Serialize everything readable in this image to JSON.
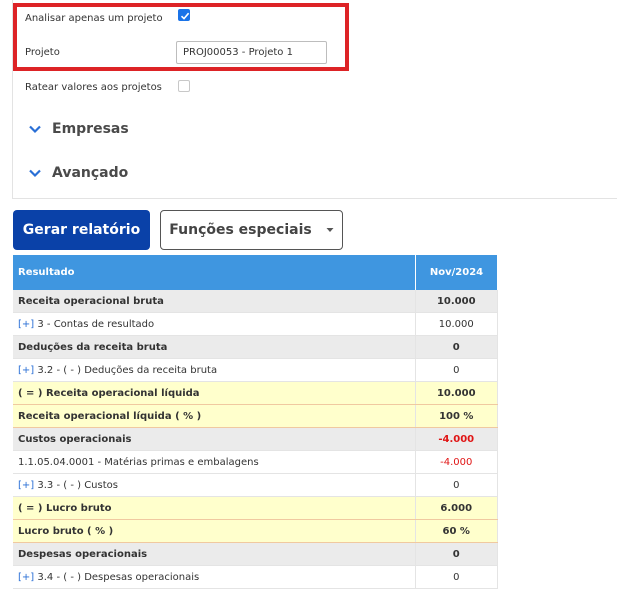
{
  "form": {
    "single_project_label": "Analisar apenas um projeto",
    "single_project_checked": true,
    "project_label": "Projeto",
    "project_value": "PROJ00053 - Projeto 1",
    "prorate_label": "Ratear valores aos projetos",
    "prorate_checked": false
  },
  "sections": {
    "empresas": "Empresas",
    "avancado": "Avançado"
  },
  "actions": {
    "generate_label": "Gerar relatório",
    "special_label": "Funções especiais"
  },
  "table": {
    "headers": [
      "Resultado",
      "Nov/2024"
    ],
    "expander": "[+]",
    "rows": [
      {
        "type": "group",
        "label": "Receita operacional bruta",
        "value": "10.000"
      },
      {
        "type": "detail",
        "expandable": true,
        "label": "3 - Contas de resultado",
        "value": "10.000"
      },
      {
        "type": "group",
        "label": "Deduções da receita bruta",
        "value": "0"
      },
      {
        "type": "detail",
        "expandable": true,
        "label": "3.2 - ( - ) Deduções da receita bruta",
        "value": "0"
      },
      {
        "type": "total",
        "label": "( = ) Receita operacional líquida",
        "value": "10.000"
      },
      {
        "type": "total",
        "label": "Receita operacional líquida ( % )",
        "value": "100 %"
      },
      {
        "type": "group",
        "label": "Custos operacionais",
        "value": "-4.000",
        "negative": true
      },
      {
        "type": "detail",
        "expandable": false,
        "label": "1.1.05.04.0001 - Matérias primas e embalagens",
        "value": "-4.000",
        "negative": true
      },
      {
        "type": "detail",
        "expandable": true,
        "label": "3.3 - ( - ) Custos",
        "value": "0"
      },
      {
        "type": "total",
        "label": "( = ) Lucro bruto",
        "value": "6.000"
      },
      {
        "type": "total",
        "label": "Lucro bruto ( % )",
        "value": "60 %"
      },
      {
        "type": "group",
        "label": "Despesas operacionais",
        "value": "0"
      },
      {
        "type": "detail",
        "expandable": true,
        "label": "3.4 - ( - ) Despesas operacionais",
        "value": "0"
      }
    ]
  },
  "colors": {
    "primary_button": "#0a41a8",
    "table_header": "#3f96e0",
    "highlight_border": "#dd2326",
    "negative": "#e01515",
    "total_row": "#ffffcc"
  },
  "icons": {
    "checkbox": "check-icon",
    "section_toggle": "chevron-down-icon",
    "dropdown": "caret-down-icon"
  }
}
